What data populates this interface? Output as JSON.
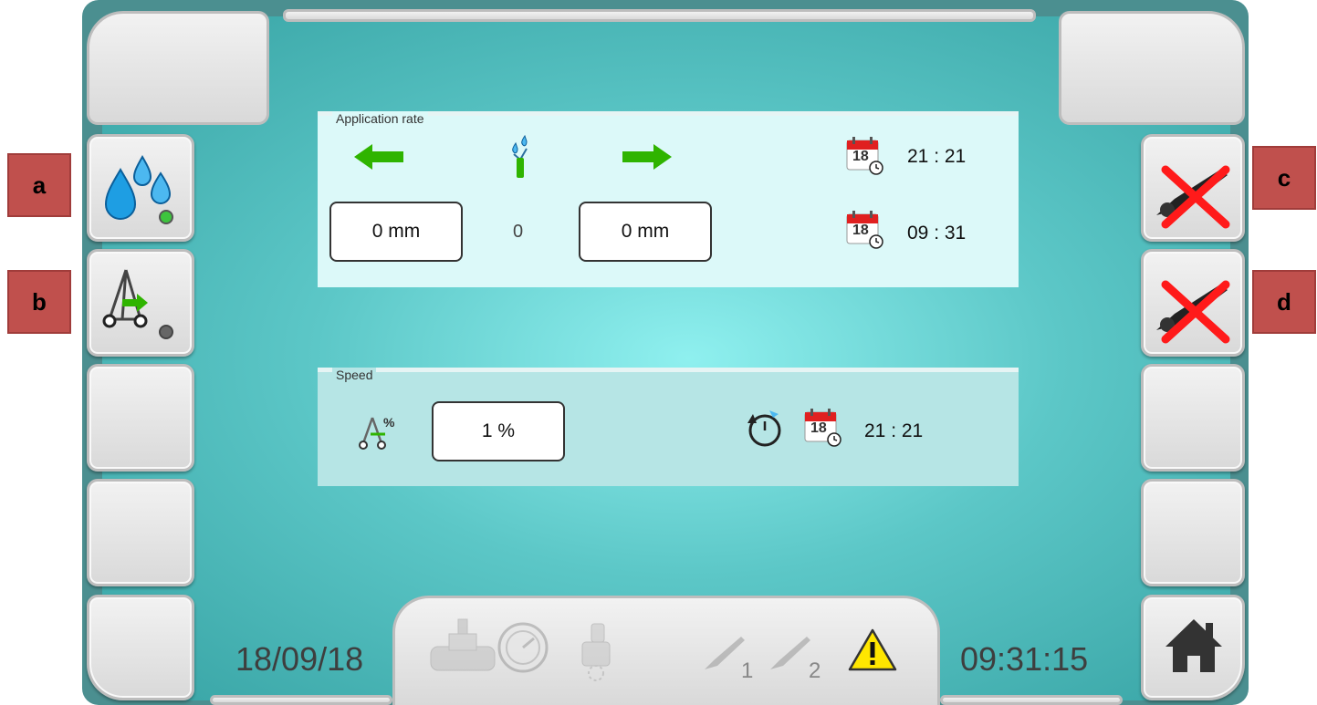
{
  "markers": {
    "a": "a",
    "b": "b",
    "c": "c",
    "d": "d"
  },
  "application_rate": {
    "legend": "Application rate",
    "left_value": "0 mm",
    "center_value": "0",
    "right_value": "0 mm",
    "calendar_day": "18",
    "time_top": "21 : 21",
    "time_bottom": "09 : 31"
  },
  "speed": {
    "legend": "Speed",
    "value": "1 %",
    "calendar_day": "18",
    "time": "21 : 21"
  },
  "status_bar": {
    "date": "18/09/18",
    "time": "09:31:15",
    "gun1": "1",
    "gun2": "2"
  },
  "colors": {
    "marker_red": "#c0504d",
    "arrow_green": "#2fb400",
    "cross_red": "#ff1a1a"
  }
}
